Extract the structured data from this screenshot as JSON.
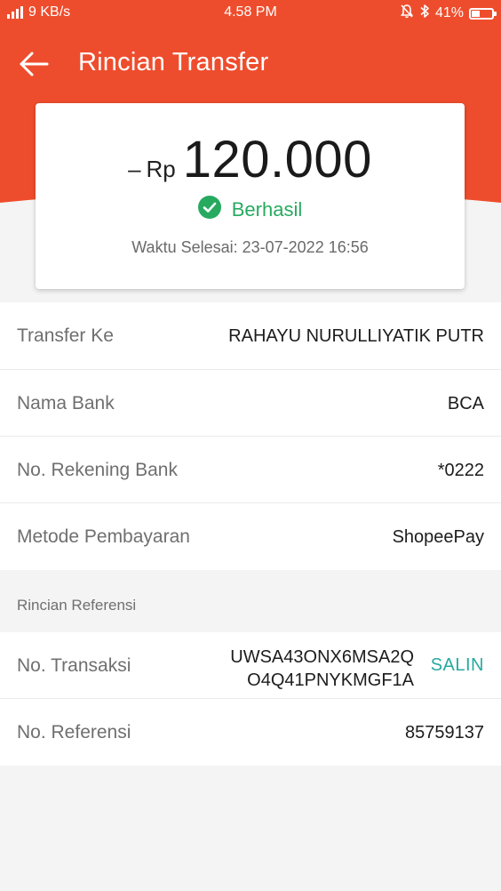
{
  "colors": {
    "header": "#ee4d2d",
    "success": "#26aa5f",
    "copy": "#26aaa0"
  },
  "status_bar": {
    "network_speed": "9 KB/s",
    "time": "4.58 PM",
    "battery": "41%",
    "battery_level": 0.41
  },
  "app_bar": {
    "title": "Rincian Transfer"
  },
  "summary": {
    "sign": "–",
    "currency": "Rp",
    "amount": "120.000",
    "status": "Berhasil",
    "time_label": "Waktu Selesai:",
    "time_value": "23-07-2022 16:56"
  },
  "details": [
    {
      "label": "Transfer Ke",
      "value": "RAHAYU NURULLIYATIK PUTR"
    },
    {
      "label": "Nama Bank",
      "value": "BCA"
    },
    {
      "label": "No. Rekening Bank",
      "value": "*0222"
    },
    {
      "label": "Metode Pembayaran",
      "value": "ShopeePay"
    }
  ],
  "reference": {
    "section_title": "Rincian Referensi",
    "transaction_label": "No. Transaksi",
    "transaction_line1": "UWSA43ONX6MSA2Q",
    "transaction_line2": "O4Q41PNYKMGF1A",
    "copy_label": "SALIN",
    "reference_label": "No. Referensi",
    "reference_value": "85759137"
  }
}
